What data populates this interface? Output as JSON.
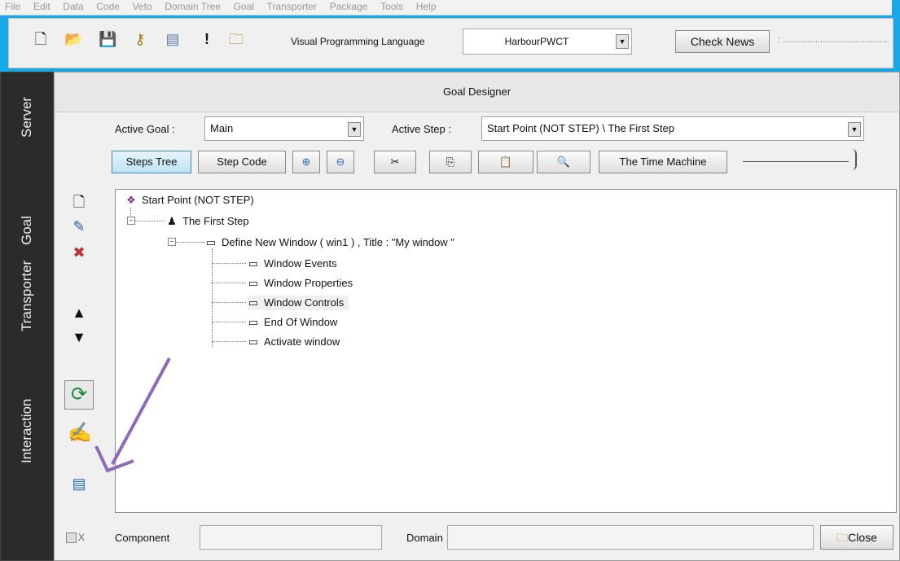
{
  "menubar": [
    "File",
    "Edit",
    "Data",
    "Code",
    "Veto",
    "Domain Tree",
    "Goal",
    "Transporter",
    "Package",
    "Tools",
    "Help"
  ],
  "toolbar": {
    "vpl_label": "Visual Programming Language",
    "vpl_value": "HarbourPWCT",
    "check_news": "Check News",
    "news_trail": ": ......................................................"
  },
  "sidetabs": [
    "Server",
    "Goal",
    "Transporter",
    "Interaction"
  ],
  "designer": {
    "title": "Goal Designer",
    "active_goal_label": "Active Goal :",
    "active_goal_value": "Main",
    "active_step_label": "Active Step :",
    "active_step_value": "Start Point (NOT STEP) \\ The First Step",
    "buttons": {
      "steps_tree": "Steps Tree",
      "step_code": "Step Code",
      "time_machine": "The Time Machine"
    }
  },
  "tree": {
    "root": "Start Point (NOT STEP)",
    "step": "The First Step",
    "define": "Define New Window  ( win1 ) , Title : \"My window  \"",
    "children": [
      "Window Events",
      "Window Properties",
      "Window Controls",
      "End Of Window",
      "Activate window"
    ]
  },
  "footer": {
    "checkbox_label": "X",
    "component_label": "Component",
    "domain_label": "Domain",
    "close": "Close"
  },
  "colors": {
    "background": "#18a8e8",
    "active_button": "#bde2f5",
    "annotation_arrow": "#8e6bb8"
  }
}
